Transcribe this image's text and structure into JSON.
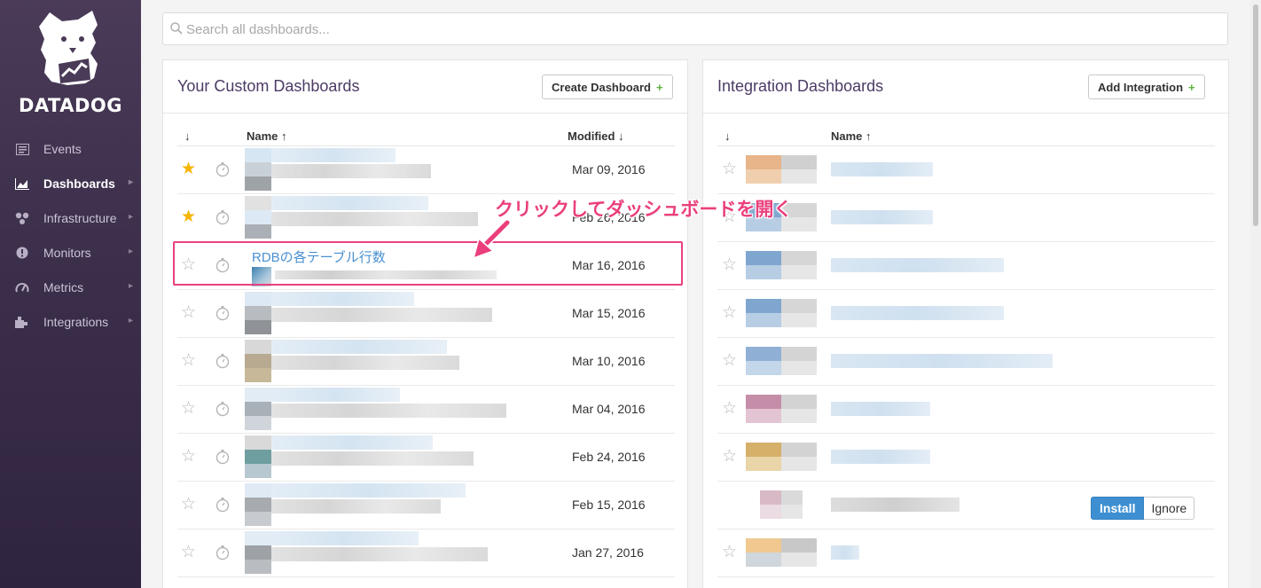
{
  "sidebar": {
    "logo_text": "DATADOG",
    "items": [
      {
        "label": "Events",
        "icon": "events-icon",
        "active": false
      },
      {
        "label": "Dashboards",
        "icon": "dashboards-icon",
        "active": true
      },
      {
        "label": "Infrastructure",
        "icon": "infrastructure-icon",
        "active": false
      },
      {
        "label": "Monitors",
        "icon": "monitors-icon",
        "active": false
      },
      {
        "label": "Metrics",
        "icon": "metrics-icon",
        "active": false
      },
      {
        "label": "Integrations",
        "icon": "integrations-icon",
        "active": false
      }
    ]
  },
  "search": {
    "placeholder": "Search all dashboards..."
  },
  "custom_panel": {
    "title": "Your Custom Dashboards",
    "create_label": "Create Dashboard",
    "sort_arrow": "↓",
    "col_name": "Name ↑",
    "col_modified": "Modified ↓",
    "rows": [
      {
        "starred": true,
        "name": "",
        "date": "Mar 09, 2016"
      },
      {
        "starred": true,
        "name": "",
        "date": "Feb 26, 2016"
      },
      {
        "starred": false,
        "name": "RDBの各テーブル行数",
        "date": "Mar 16, 2016"
      },
      {
        "starred": false,
        "name": "",
        "date": "Mar 15, 2016"
      },
      {
        "starred": false,
        "name": "",
        "date": "Mar 10, 2016"
      },
      {
        "starred": false,
        "name": "",
        "date": "Mar 04, 2016"
      },
      {
        "starred": false,
        "name": "",
        "date": "Feb 24, 2016"
      },
      {
        "starred": false,
        "name": "",
        "date": "Feb 15, 2016"
      },
      {
        "starred": false,
        "name": "",
        "date": "Jan 27, 2016"
      }
    ]
  },
  "integration_panel": {
    "title": "Integration Dashboards",
    "add_label": "Add Integration",
    "sort_arrow": "↓",
    "col_name": "Name ↑",
    "install_label": "Install",
    "ignore_label": "Ignore"
  },
  "annotation": {
    "text": "クリックしてダッシュボードを開く"
  },
  "colors": {
    "accent": "#e8417f",
    "link": "#4a90d0",
    "star": "#f5b400",
    "install": "#3d8fd1"
  }
}
